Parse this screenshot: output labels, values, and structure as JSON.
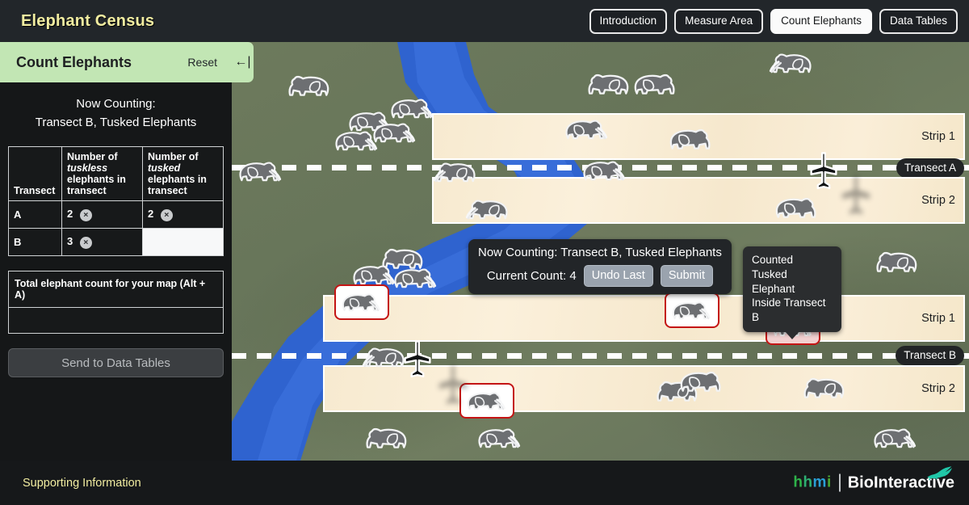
{
  "header": {
    "title": "Elephant Census",
    "tabs": [
      {
        "label": "Introduction",
        "active": false
      },
      {
        "label": "Measure Area",
        "active": false
      },
      {
        "label": "Count Elephants",
        "active": true
      },
      {
        "label": "Data Tables",
        "active": false
      }
    ]
  },
  "sidebar": {
    "title": "Count Elephants",
    "reset_label": "Reset",
    "collapse_icon": "←|",
    "now_counting_label": "Now Counting:",
    "now_counting_value": "Transect B, Tusked Elephants",
    "table": {
      "headers": [
        "Transect",
        "Number of tuskless elephants in transect",
        "Number of tusked elephants in transect"
      ],
      "header_parts": {
        "col0": "Transect",
        "col1_a": "Number of",
        "col1_em": "tuskless",
        "col1_b": "elephants in transect",
        "col2_a": "Number of",
        "col2_em": "tusked",
        "col2_b": "elephants in transect"
      },
      "rows": [
        {
          "transect": "A",
          "tuskless": "2",
          "tusked": "2",
          "tusked_empty": false
        },
        {
          "transect": "B",
          "tuskless": "3",
          "tusked": "",
          "tusked_empty": true
        }
      ],
      "clear_icon": "×"
    },
    "total_label": "Total elephant count for your map (Alt + A)",
    "total_value": "",
    "send_label": "Send to Data Tables"
  },
  "map": {
    "transects": [
      {
        "id": "A",
        "pill_label": "Transect A",
        "strip1_label": "Strip 1",
        "strip2_label": "Strip 2"
      },
      {
        "id": "B",
        "pill_label": "Transect B",
        "strip1_label": "Strip 1",
        "strip2_label": "Strip 2"
      }
    ],
    "count_panel": {
      "status": "Now Counting: Transect B, Tusked Elephants",
      "count_label": "Current Count: 4",
      "undo_label": "Undo Last",
      "submit_label": "Submit"
    },
    "tooltip": {
      "line1": "Counted",
      "line2": "Tusked Elephant",
      "line3": "Inside Transect B"
    },
    "colors": {
      "terrain": "#6b7a5a",
      "river": "#2a5fc8",
      "strip": "#f8ecd6",
      "counted_border": "#c41414",
      "accent_green": "#c2e6b4",
      "brand_yellow": "#f2eda1"
    }
  },
  "footer": {
    "support_link": "Supporting Information",
    "logo_hhmi": "hhmi",
    "logo_bio": "BioInteractive"
  }
}
